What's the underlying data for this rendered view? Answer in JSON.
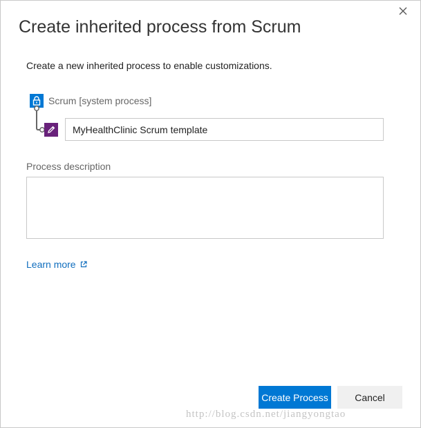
{
  "dialog": {
    "title": "Create inherited process from Scrum",
    "subtitle": "Create a new inherited process to enable customizations.",
    "close_icon": "close-icon"
  },
  "parent_process": {
    "icon": "lock-icon",
    "label": "Scrum [system process]"
  },
  "new_process": {
    "icon": "edit-icon",
    "name_value": "MyHealthClinic Scrum template"
  },
  "description": {
    "label": "Process description",
    "value": ""
  },
  "learn_more": {
    "label": "Learn more",
    "icon": "external-link-icon"
  },
  "buttons": {
    "create_label": "Create Process",
    "cancel_label": "Cancel"
  },
  "watermark": "http://blog.csdn.net/jiangyongtao",
  "colors": {
    "primary": "#0078d4",
    "edit_badge": "#68217a",
    "link": "#106ebe"
  }
}
